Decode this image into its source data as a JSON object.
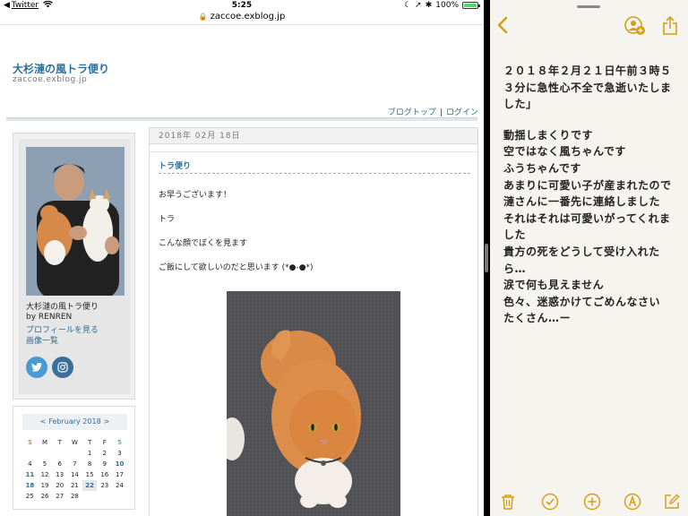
{
  "status_bar": {
    "back_app": "Twitter",
    "time": "5:25",
    "battery": "100%",
    "battery_level": 1.0
  },
  "url_bar": {
    "domain": "zaccoe.exblog.jp"
  },
  "blog": {
    "title": "大杉漣の風トラ便り",
    "url": "zaccoe.exblog.jp",
    "top_links": [
      "ブログトップ",
      "ログイン"
    ]
  },
  "profile": {
    "name": "大杉漣の風トラ便り",
    "by": "by RENREN",
    "profile_link": "プロフィールを見る",
    "images_link": "画像一覧"
  },
  "calendar": {
    "prev": "<",
    "month": "February 2018",
    "next": ">",
    "weekdays": [
      "S",
      "M",
      "T",
      "W",
      "T",
      "F",
      "S"
    ],
    "weeks": [
      [
        "",
        "",
        "",
        "",
        "1",
        "2",
        "3"
      ],
      [
        "4",
        "5",
        "6",
        "7",
        "8",
        "9",
        "10"
      ],
      [
        "11",
        "12",
        "13",
        "14",
        "15",
        "16",
        "17"
      ],
      [
        "18",
        "19",
        "20",
        "21",
        "22",
        "23",
        "24"
      ],
      [
        "25",
        "26",
        "27",
        "28",
        "",
        "",
        ""
      ]
    ]
  },
  "post": {
    "date": "2018年 02月 18日",
    "title": "トラ便り",
    "lines": [
      "お早うございます！",
      "トラ",
      "こんな顔でぼくを見ます",
      "ご飯にして欲しいのだと思います (*●-●*)"
    ]
  },
  "notes": {
    "paragraphs": [
      [
        "２０１８年２月２１日午前３時５",
        "３分に急性心不全で急逝いたしま",
        "した」"
      ],
      [
        "動揺しまくりです",
        "空ではなく風ちゃんです",
        "ふうちゃんです",
        "あまりに可愛い子が産まれたので",
        "漣さんに一番先に連絡しました",
        "それはそれは可愛いがってくれま",
        "した",
        "貴方の死をどうして受け入れた",
        "ら…",
        "涙で何も見えません",
        "色々、迷惑かけてごめんなさい",
        "たくさん…ー"
      ]
    ]
  },
  "colors": {
    "link_blue": "#2b6f9b",
    "notes_accent": "#d4a017",
    "notes_bg": "#f5f4ef"
  },
  "icons": {
    "notes_toolbar": [
      "trash-icon",
      "checklist-icon",
      "add-icon",
      "markup-icon",
      "compose-icon"
    ]
  }
}
